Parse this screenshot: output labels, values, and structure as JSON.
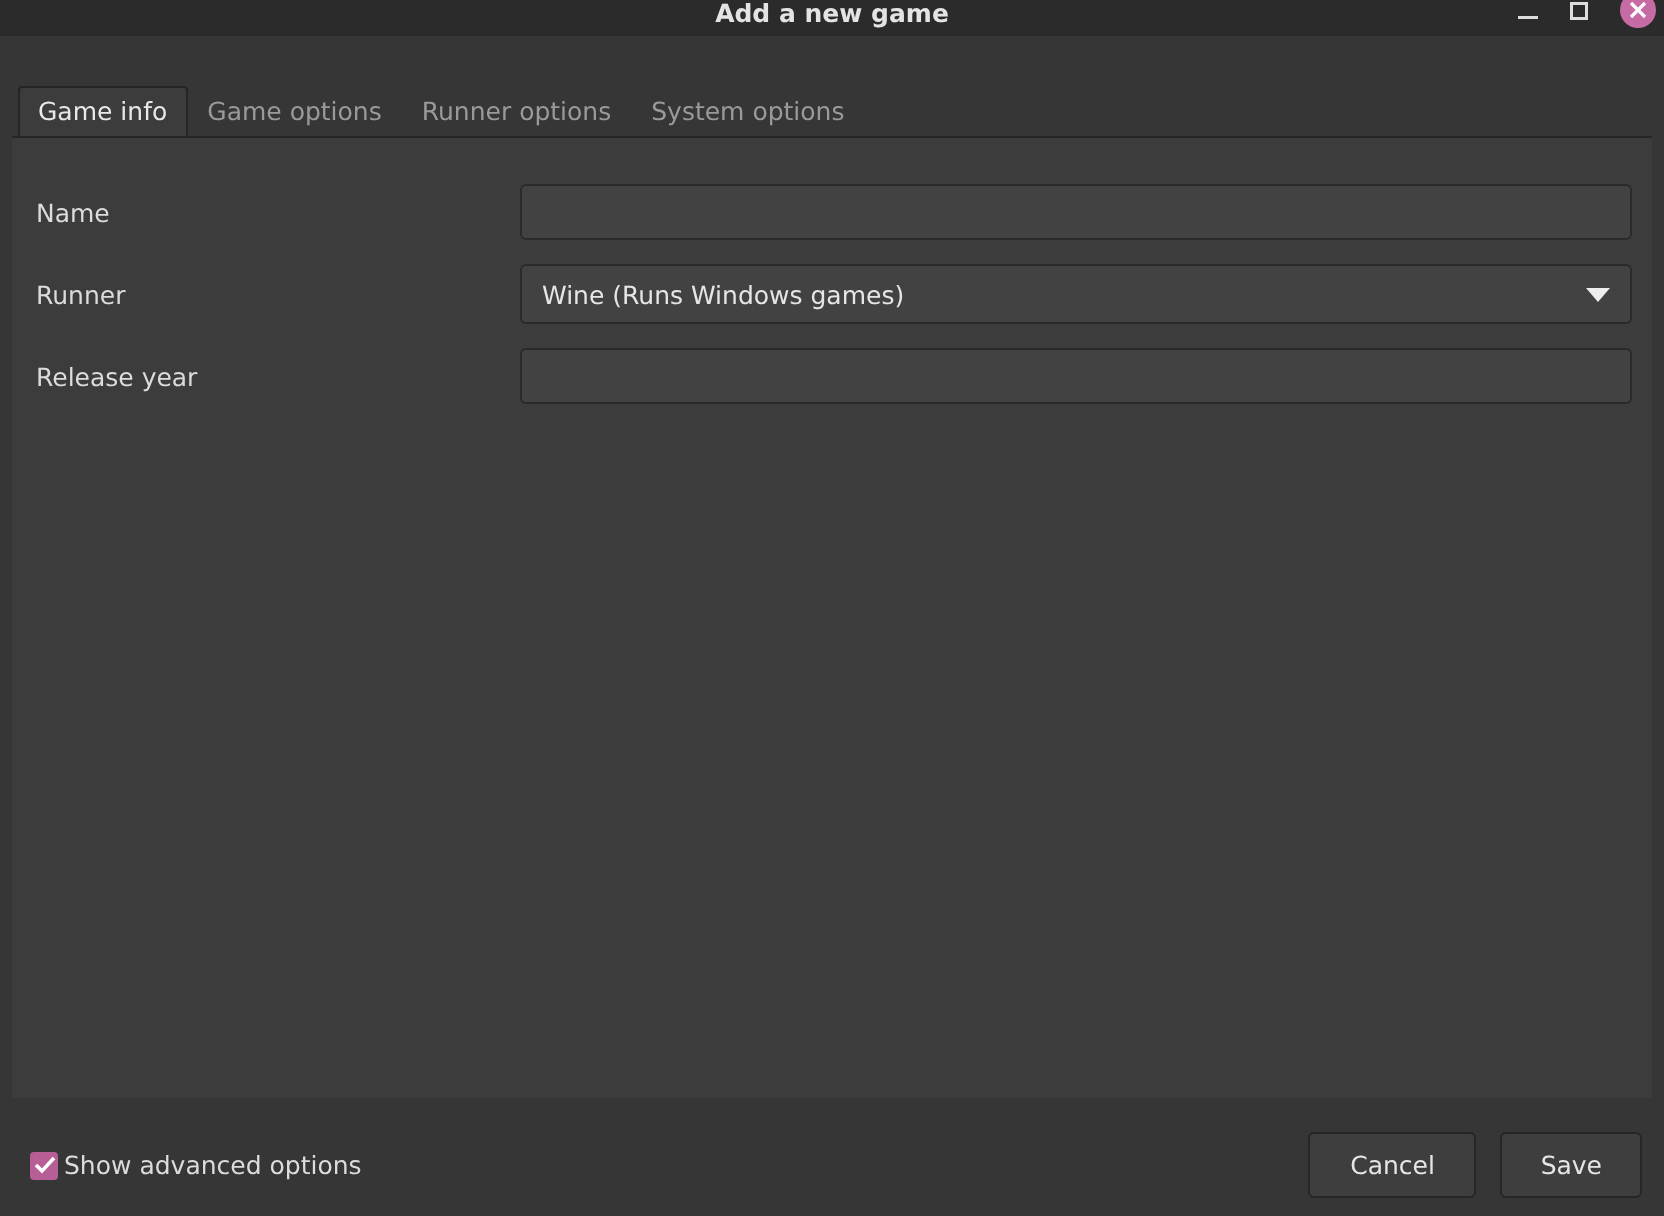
{
  "window": {
    "title": "Add a new game"
  },
  "tabs": [
    {
      "label": "Game info",
      "selected": true
    },
    {
      "label": "Game options",
      "selected": false
    },
    {
      "label": "Runner options",
      "selected": false
    },
    {
      "label": "System options",
      "selected": false
    }
  ],
  "fields": [
    {
      "label": "Name",
      "kind": "text"
    },
    {
      "label": "Runner",
      "kind": "dropdown",
      "value": "Wine (Runs Windows games)"
    },
    {
      "label": "Release year",
      "kind": "text"
    }
  ],
  "advanced_options": {
    "label": "Show advanced options",
    "checked": true
  },
  "buttons": [
    "Cancel",
    "Save"
  ]
}
